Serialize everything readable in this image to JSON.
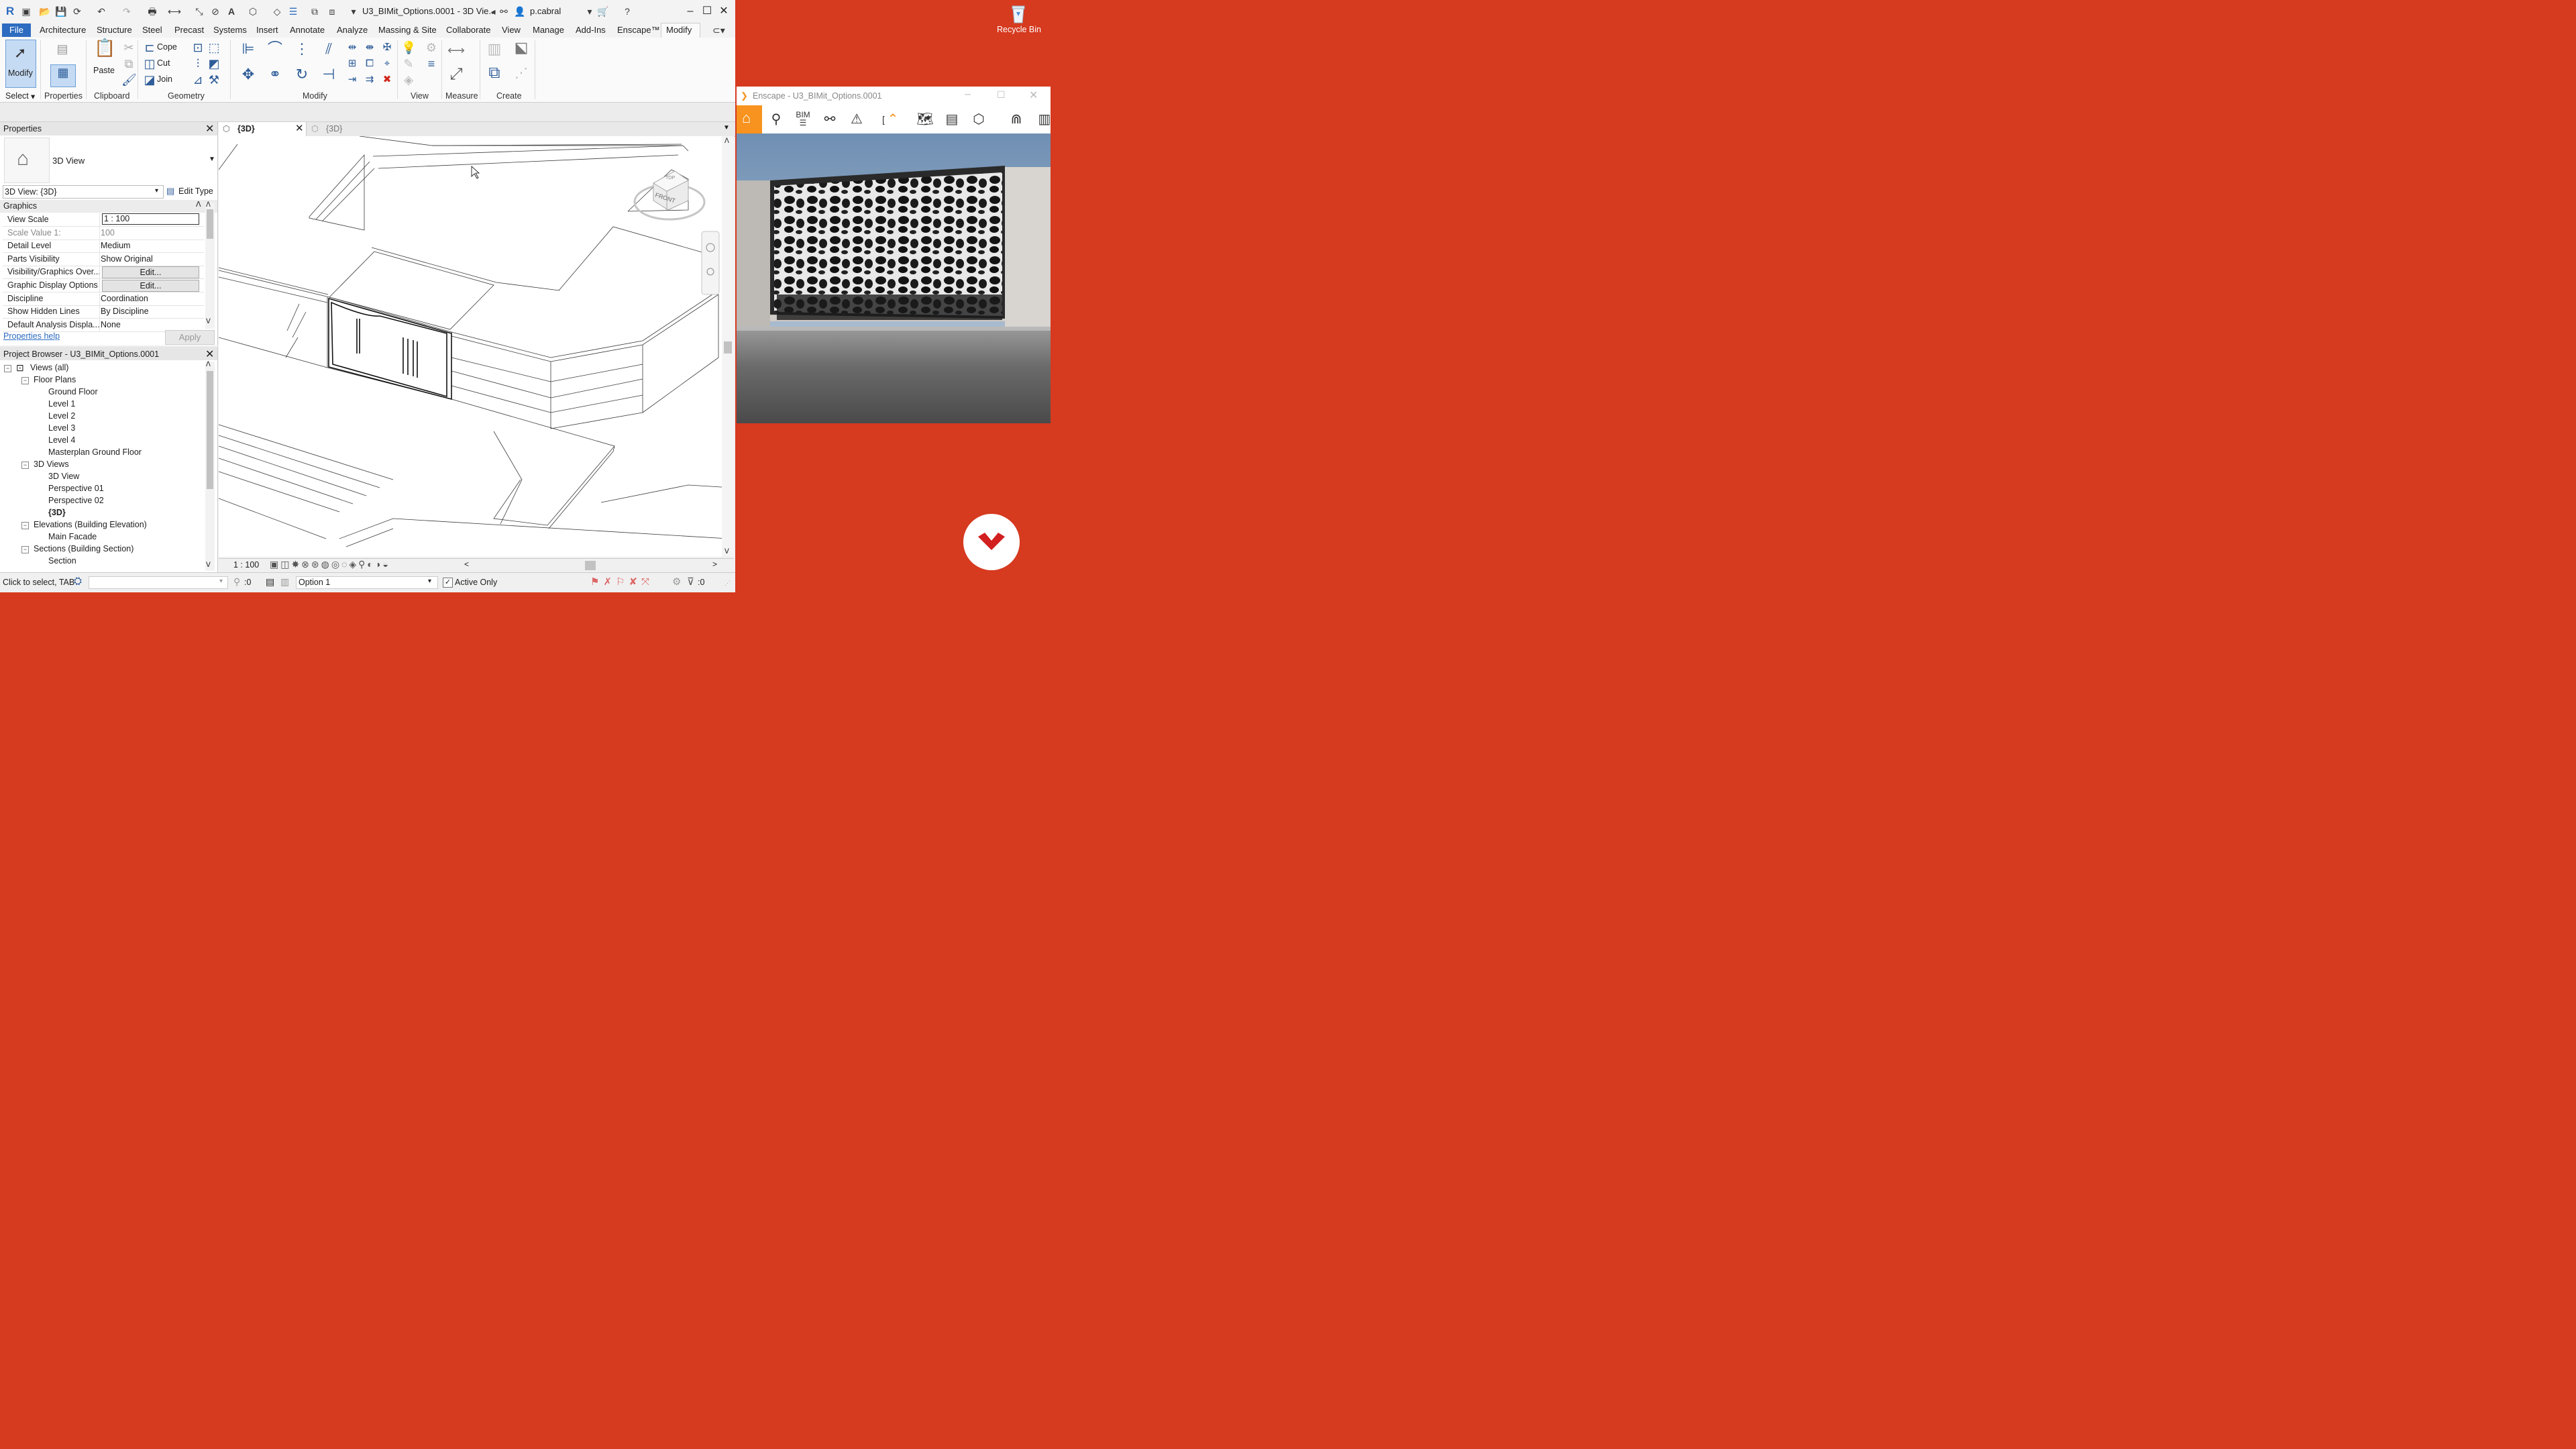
{
  "revit": {
    "title": "U3_BIMit_Options.0001 - 3D Vie...",
    "user": "p.cabral",
    "menu": [
      "File",
      "Architecture",
      "Structure",
      "Steel",
      "Precast",
      "Systems",
      "Insert",
      "Annotate",
      "Analyze",
      "Massing & Site",
      "Collaborate",
      "View",
      "Manage",
      "Add-Ins",
      "Enscape™",
      "Modify"
    ],
    "ribbon": {
      "modify_label": "Modify",
      "select_label": "Select",
      "groups": [
        "Properties",
        "Clipboard",
        "Geometry",
        "Modify",
        "View",
        "Measure",
        "Create"
      ],
      "paste_label": "Paste",
      "cope_label": "Cope",
      "cut_label": "Cut",
      "join_label": "Join"
    },
    "properties": {
      "header": "Properties",
      "type_name": "3D View",
      "instance_selector": "3D View: {3D}",
      "edit_type": "Edit Type",
      "section": "Graphics",
      "rows": [
        {
          "key": "View Scale",
          "value": "1 : 100"
        },
        {
          "key": "Scale Value    1:",
          "value": "100"
        },
        {
          "key": "Detail Level",
          "value": "Medium"
        },
        {
          "key": "Parts Visibility",
          "value": "Show Original"
        },
        {
          "key": "Visibility/Graphics Over...",
          "value": "Edit..."
        },
        {
          "key": "Graphic Display Options",
          "value": "Edit..."
        },
        {
          "key": "Discipline",
          "value": "Coordination"
        },
        {
          "key": "Show Hidden Lines",
          "value": "By Discipline"
        },
        {
          "key": "Default Analysis Displa...",
          "value": "None"
        }
      ],
      "help": "Properties help",
      "apply": "Apply"
    },
    "browser": {
      "header": "Project Browser - U3_BIMit_Options.0001",
      "root": "Views (all)",
      "floor_plans": "Floor Plans",
      "floor_items": [
        "Ground Floor",
        "Level 1",
        "Level 2",
        "Level 3",
        "Level 4",
        "Masterplan Ground Floor"
      ],
      "views3d": "3D Views",
      "views3d_items": [
        "3D View",
        "Perspective 01",
        "Perspective 02",
        "{3D}"
      ],
      "elevations": "Elevations (Building Elevation)",
      "elevation_items": [
        "Main Facade"
      ],
      "sections": "Sections (Building Section)",
      "section_items": [
        "Section"
      ]
    },
    "view_tabs": [
      "{3D}",
      "{3D}"
    ],
    "viewcube": {
      "top": "TOP",
      "front": "FRONT"
    },
    "view_scale": "1 : 100",
    "status": {
      "hint": "Click to select, TAB",
      "filter_count": ":0",
      "option": "Option 1",
      "active_only": "Active Only",
      "right_count": ":0"
    }
  },
  "desktop": {
    "recycle_bin": "Recycle Bin"
  },
  "enscape": {
    "title": "Enscape - U3_BIMit_Options.0001",
    "bim_label": "BIM"
  },
  "colors": {
    "desktop_bg": "#d63a1f",
    "enscape_accent": "#f7931e",
    "revit_blue": "#2d6cc0"
  }
}
